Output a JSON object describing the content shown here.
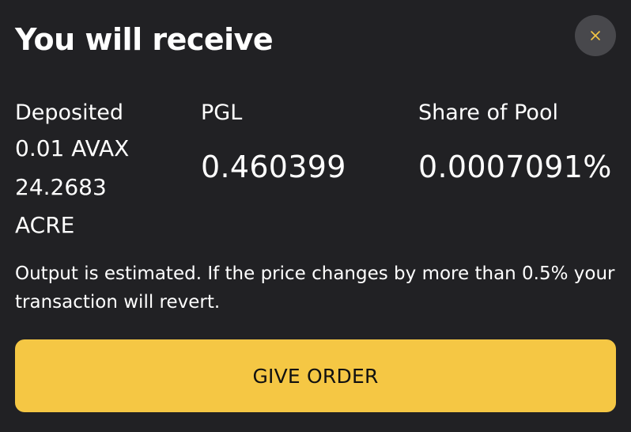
{
  "modal": {
    "title": "You will receive",
    "close_icon": "close-icon"
  },
  "summary": {
    "deposited": {
      "label": "Deposited",
      "lines": [
        "0.01 AVAX",
        "24.2683",
        "ACRE"
      ]
    },
    "pgl": {
      "label": "PGL",
      "value": "0.460399"
    },
    "share": {
      "label": "Share of Pool",
      "value": "0.0007091%"
    }
  },
  "note": "Output is estimated. If the price changes by more than 0.5% your transaction will revert.",
  "action": {
    "label": "GIVE ORDER"
  },
  "colors": {
    "background": "#212124",
    "accent": "#f5c744",
    "close_bg": "#48484c"
  }
}
